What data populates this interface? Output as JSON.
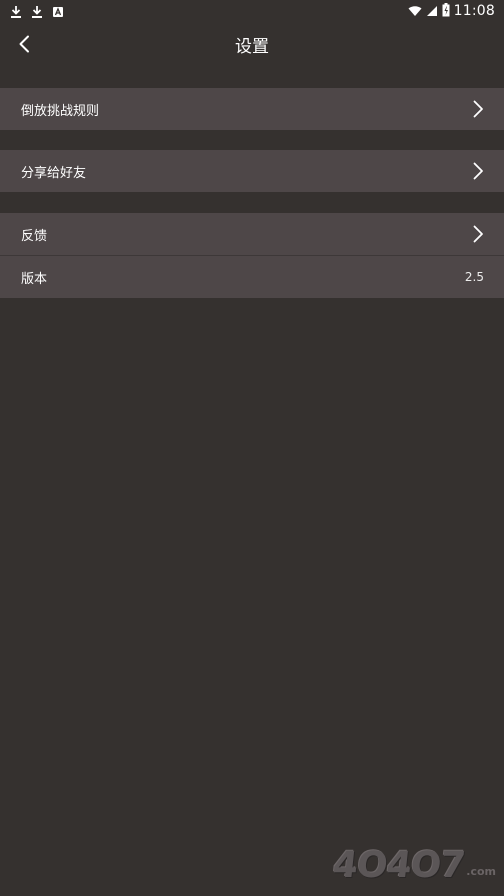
{
  "status_bar": {
    "left_icons": [
      "download-icon",
      "download-icon",
      "app-notification-icon"
    ],
    "right_icons": [
      "wifi-icon",
      "signal-icon",
      "battery-icon"
    ],
    "time": "11:08"
  },
  "toolbar": {
    "back_icon": "chevron-left-icon",
    "title": "设置"
  },
  "groups": [
    {
      "rows": [
        {
          "label": "倒放挑战规则",
          "trailing": "chevron-right-icon"
        }
      ]
    },
    {
      "rows": [
        {
          "label": "分享给好友",
          "trailing": "chevron-right-icon"
        }
      ]
    },
    {
      "rows": [
        {
          "label": "反馈",
          "trailing": "chevron-right-icon"
        },
        {
          "label": "版本",
          "value": "2.5"
        }
      ]
    }
  ],
  "watermark": {
    "text": "4O4O7",
    "suffix": ".com"
  },
  "colors": {
    "background": "#35312f",
    "row_background": "#4e4748",
    "text": "#ffffff"
  }
}
